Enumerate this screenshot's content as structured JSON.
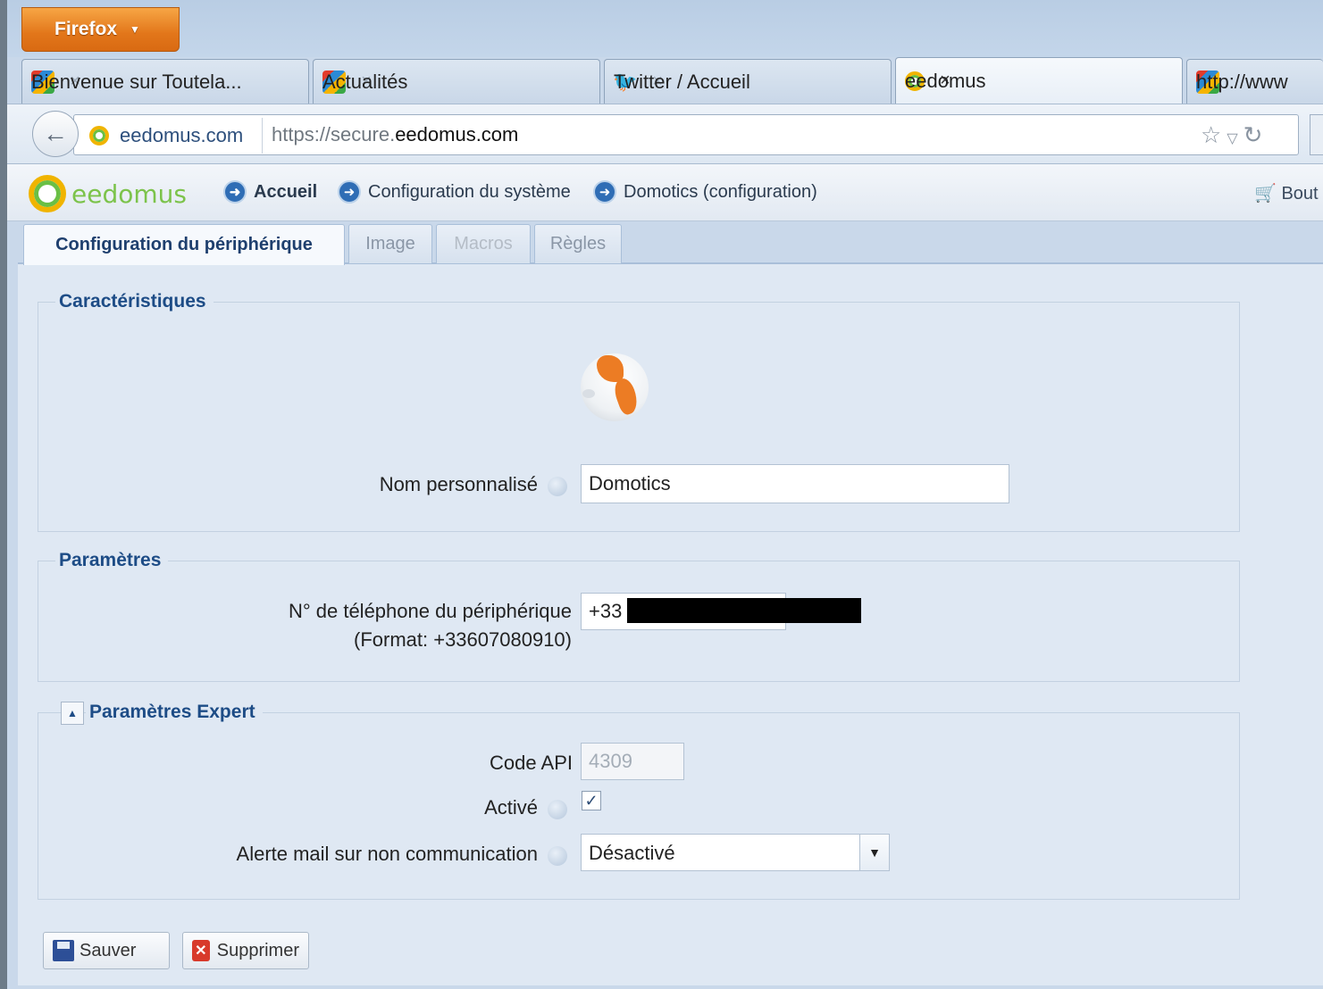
{
  "browser": {
    "menu_button": "Firefox",
    "tabs": [
      {
        "label": "Bienvenue sur Toutela...",
        "active": false
      },
      {
        "label": "Actualités",
        "active": false
      },
      {
        "label": "Twitter / Accueil",
        "active": false
      },
      {
        "label": "eedomus",
        "active": true
      },
      {
        "label": "http://www",
        "active": false
      }
    ],
    "close_glyph": "×",
    "identity": "eedomus.com",
    "url_prefix": "https://secure.",
    "url_domain": "eedomus.com"
  },
  "app": {
    "logo": "eedomus",
    "menu": [
      {
        "label": "Accueil"
      },
      {
        "label": "Configuration du système"
      },
      {
        "label": "Domotics (configuration)"
      }
    ],
    "cart": "Bout"
  },
  "page_tabs": [
    {
      "label": "Configuration du périphérique",
      "state": "active"
    },
    {
      "label": "Image",
      "state": "normal"
    },
    {
      "label": "Macros",
      "state": "disabled"
    },
    {
      "label": "Règles",
      "state": "normal"
    }
  ],
  "sections": {
    "characteristics": {
      "legend": "Caractéristiques",
      "name_label": "Nom personnalisé",
      "name_value": "Domotics"
    },
    "parameters": {
      "legend": "Paramètres",
      "phone_label": "N° de téléphone du périphérique",
      "phone_format": "(Format: +33607080910)",
      "phone_value": "+33"
    },
    "expert": {
      "legend": "Paramètres Expert",
      "api_label": "Code API",
      "api_value": "4309",
      "active_label": "Activé",
      "active_checked": true,
      "alert_label": "Alerte mail sur non communication",
      "alert_value": "Désactivé"
    }
  },
  "actions": {
    "save": "Sauver",
    "delete": "Supprimer"
  },
  "colors": {
    "firefox_orange": "#e2761a",
    "legend_blue": "#1d4c86",
    "logo_green": "#7cc34b",
    "logo_yellow": "#f0b400",
    "globe_orange": "#ec7c24"
  }
}
